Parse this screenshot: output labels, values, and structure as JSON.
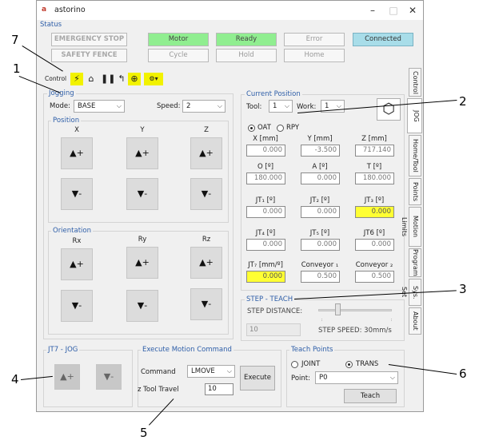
{
  "window": {
    "title": "astorino",
    "logo": "a",
    "minimize": "–",
    "maximize": "□",
    "close": "✕"
  },
  "status": {
    "label": "Status",
    "emergency_stop": "EMERGENCY STOP",
    "safety_fence": "SAFETY FENCE",
    "motor": "Motor",
    "ready": "Ready",
    "error": "Error",
    "connected": "Connected",
    "cycle": "Cycle",
    "hold": "Hold",
    "home": "Home"
  },
  "toolbar": {
    "label": "Control"
  },
  "jogging": {
    "title": "Jogging",
    "mode_label": "Mode:",
    "mode_value": "BASE",
    "speed_label": "Speed:",
    "speed_value": "2",
    "position_title": "Position",
    "orientation_title": "Orientation",
    "axes_pos": [
      "X",
      "Y",
      "Z"
    ],
    "axes_ori": [
      "Rx",
      "Ry",
      "Rz"
    ],
    "plus_label": "▲+",
    "minus_label": "▼-"
  },
  "current_position": {
    "title": "Current Position",
    "tool_label": "Tool:",
    "tool_value": "1",
    "work_label": "Work:",
    "work_value": "1",
    "oat_label": "OAT",
    "rpy_label": "RPY",
    "fields": [
      {
        "label": "X [mm]",
        "value": "0.000"
      },
      {
        "label": "Y [mm]",
        "value": "-3.500"
      },
      {
        "label": "Z  [mm]",
        "value": "717.140"
      },
      {
        "label": "O [º]",
        "value": "180.000"
      },
      {
        "label": "A [º]",
        "value": "0.000"
      },
      {
        "label": "T [º]",
        "value": "180.000"
      },
      {
        "label": "JT₁ [º]",
        "value": "0.000"
      },
      {
        "label": "JT₂ [º]",
        "value": "0.000"
      },
      {
        "label": "JT₃ [º]",
        "value": "0.000"
      },
      {
        "label": "JT₄ [º]",
        "value": "0.000"
      },
      {
        "label": "JT₅ [º]",
        "value": "0.000"
      },
      {
        "label": "JT6 [º]",
        "value": "0.000"
      },
      {
        "label": "JT₇ [mm/º]",
        "value": "0.000"
      },
      {
        "label": "Conveyor ₁",
        "value": "0.500"
      },
      {
        "label": "Conveyor ₂",
        "value": "0.500"
      }
    ]
  },
  "step_teach": {
    "title": "STEP - TEACH",
    "distance_label": "STEP DISTANCE:",
    "distance_value": "10",
    "speed_label": "STEP SPEED: 30mm/s",
    "slider_level": 0.25
  },
  "jt7_jog": {
    "title": "JT7 - JOG",
    "plus": "▲+",
    "minus": "▼-"
  },
  "execute": {
    "title": "Execute Motion Command",
    "command_label": "Command",
    "command_value": "LMOVE",
    "ztool_label": "z Tool Travel",
    "ztool_value": "10",
    "execute_button": "Execute"
  },
  "teach_points": {
    "title": "Teach Points",
    "joint_label": "JOINT",
    "trans_label": "TRANS",
    "point_label": "Point:",
    "point_value": "P0",
    "teach_button": "Teach"
  },
  "tabs": [
    "Control",
    "JOG",
    "Home/Tool",
    "Points",
    "Motion Limits",
    "Program",
    "Sys. Set",
    "About"
  ],
  "annotations": [
    "1",
    "2",
    "3",
    "4",
    "5",
    "6",
    "7"
  ],
  "colors": {
    "accent_blue": "#2e5ea8",
    "highlight_yellow": "#ffff33",
    "status_green": "#90ee90",
    "connected_blue": "#a8dde9"
  }
}
